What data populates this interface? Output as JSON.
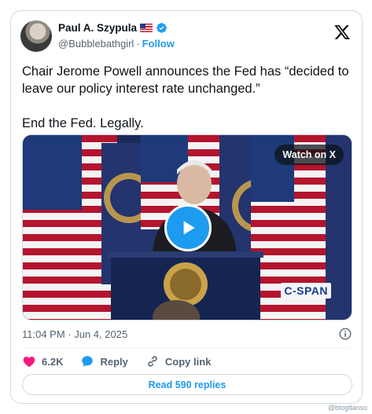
{
  "author": {
    "name": "Paul A. Szypula",
    "handle": "@Bubblebathgirl",
    "separator": "·",
    "follow_label": "Follow",
    "flag_icon": "us-flag-icon",
    "verified_icon": "verified-badge-icon"
  },
  "tweet": {
    "text_paragraphs": [
      "Chair Jerome Powell announces the Fed has “decided to leave our policy interest rate unchanged.”",
      "End the Fed. Legally."
    ]
  },
  "media": {
    "watch_label": "Watch on X",
    "broadcaster_label": "C-SPAN"
  },
  "meta": {
    "timestamp": "11:04 PM · Jun 4, 2025"
  },
  "actions": {
    "like_count": "6.2K",
    "reply_label": "Reply",
    "copy_link_label": "Copy link"
  },
  "replies_button": {
    "label": "Read 590 replies"
  },
  "watermark": "@blogtlanso",
  "colors": {
    "accent": "#1d9bf0",
    "like": "#f91880",
    "text": "#0f1419",
    "muted": "#536471",
    "border": "#cfd9de"
  }
}
